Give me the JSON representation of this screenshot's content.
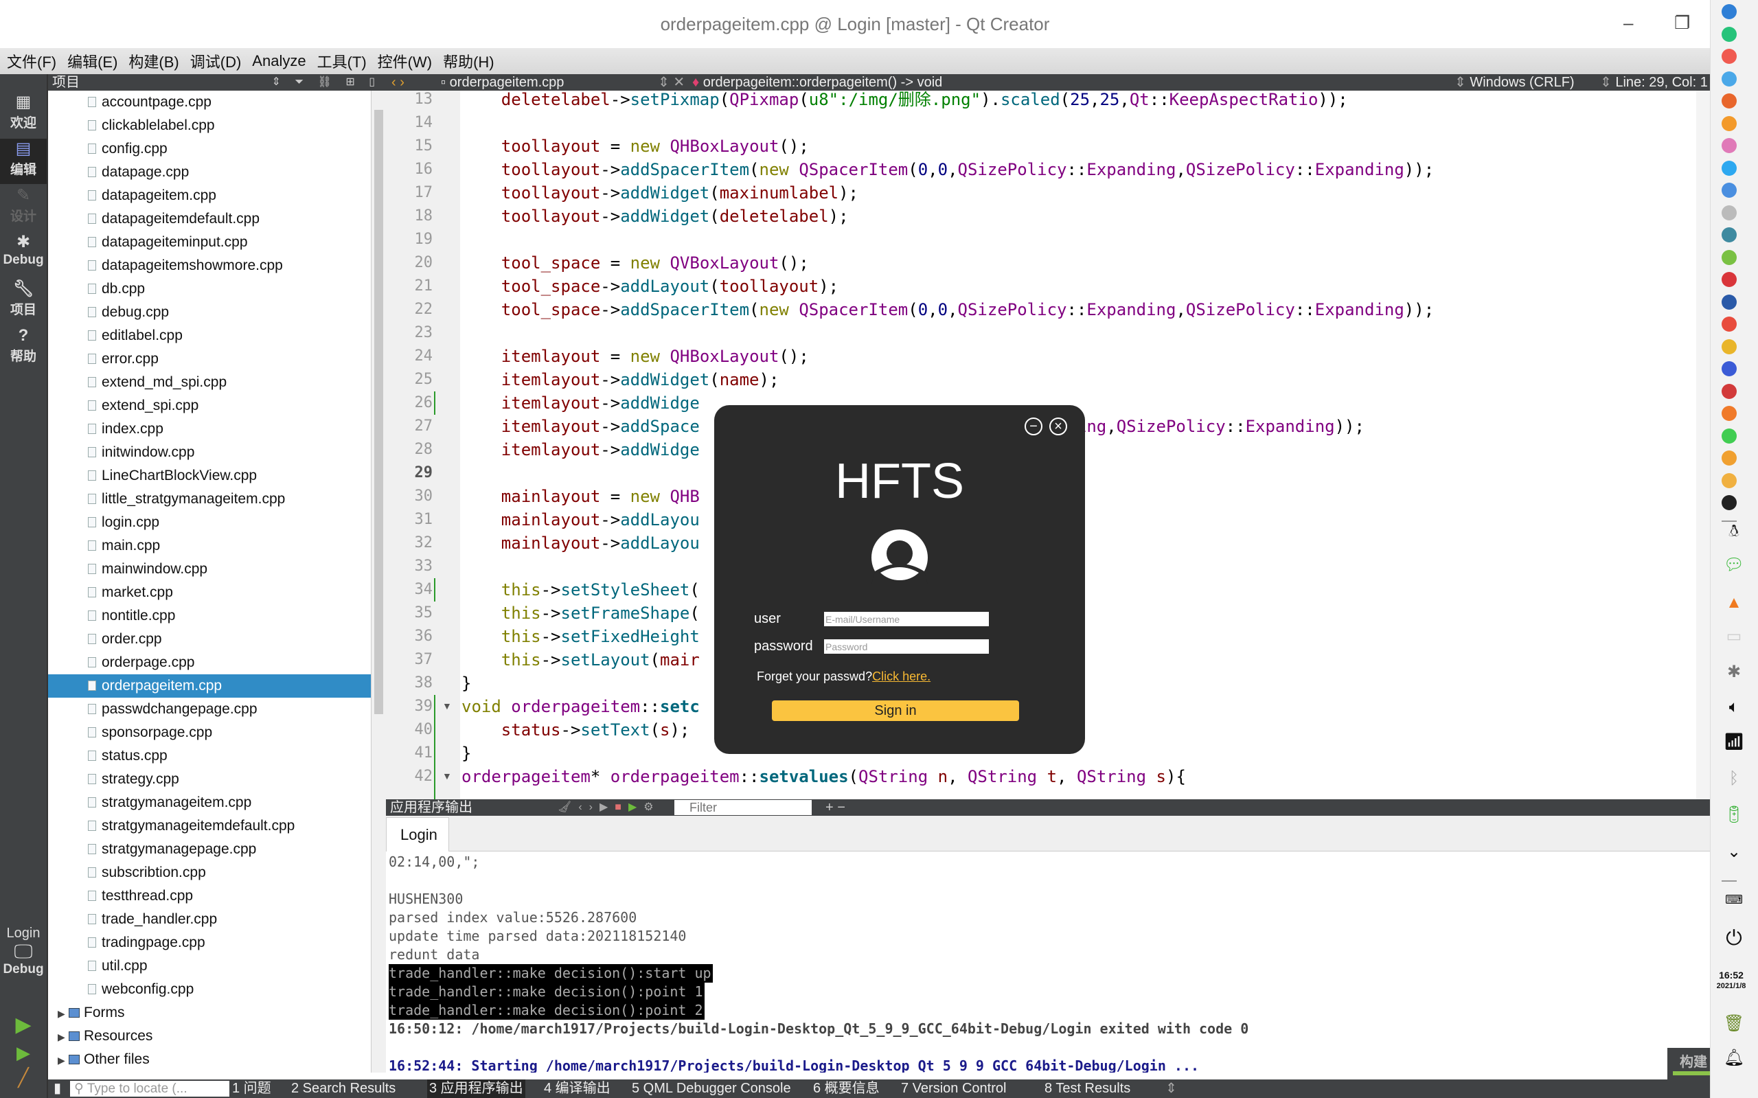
{
  "window": {
    "title": "orderpageitem.cpp @ Login [master] - Qt Creator",
    "minimize_glyph": "–",
    "restore_glyph": "❐"
  },
  "menubar": [
    "文件(F)",
    "编辑(E)",
    "构建(B)",
    "调试(D)",
    "Analyze",
    "工具(T)",
    "控件(W)",
    "帮助(H)"
  ],
  "modes": [
    {
      "label": "欢迎",
      "icon": "grid-icon"
    },
    {
      "label": "编辑",
      "icon": "edit-document-icon",
      "active": true
    },
    {
      "label": "设计",
      "icon": "pencil-icon",
      "disabled": true
    },
    {
      "label": "Debug",
      "icon": "bug-icon"
    },
    {
      "label": "项目",
      "icon": "wrench-icon"
    },
    {
      "label": "帮助",
      "icon": "help-icon"
    }
  ],
  "run_target": {
    "project": "Login",
    "config": "Debug"
  },
  "project_panel": {
    "title": "项目",
    "files": [
      "accountpage.cpp",
      "clickablelabel.cpp",
      "config.cpp",
      "datapage.cpp",
      "datapageitem.cpp",
      "datapageitemdefault.cpp",
      "datapageiteminput.cpp",
      "datapageitemshowmore.cpp",
      "db.cpp",
      "debug.cpp",
      "editlabel.cpp",
      "error.cpp",
      "extend_md_spi.cpp",
      "extend_spi.cpp",
      "index.cpp",
      "initwindow.cpp",
      "LineChartBlockView.cpp",
      "little_stratgymanageitem.cpp",
      "login.cpp",
      "main.cpp",
      "mainwindow.cpp",
      "market.cpp",
      "nontitle.cpp",
      "order.cpp",
      "orderpage.cpp",
      "orderpageitem.cpp",
      "passwdchangepage.cpp",
      "sponsorpage.cpp",
      "status.cpp",
      "strategy.cpp",
      "stratgymanageitem.cpp",
      "stratgymanageitemdefault.cpp",
      "stratgymanagepage.cpp",
      "subscribtion.cpp",
      "testthread.cpp",
      "trade_handler.cpp",
      "tradingpage.cpp",
      "util.cpp",
      "webconfig.cpp"
    ],
    "selected_file": "orderpageitem.cpp",
    "folders": [
      "Forms",
      "Resources",
      "Other files"
    ]
  },
  "editor_toolbar": {
    "file": "orderpageitem.cpp",
    "symbol": "orderpageitem::orderpageitem() -> void",
    "line_ending": "Windows (CRLF)",
    "position": "Line: 29, Col: 1"
  },
  "editor": {
    "current_line": 29,
    "lines": [
      {
        "n": 13,
        "html": "    <span class='v'>deletelabel</span>-><span class='f'>setPixmap</span>(<span class='t'>QPixmap</span>(<span class='s'>u8\":/img/删除.png\"</span>).<span class='f'>scaled</span>(<span class='n'>25</span>,<span class='n'>25</span>,<span class='t'>Qt</span>::<span class='t'>KeepAspectRatio</span>));"
      },
      {
        "n": 14,
        "html": ""
      },
      {
        "n": 15,
        "html": "    <span class='v'>toollayout</span> = <span class='k'>new</span> <span class='t'>QHBoxLayout</span>();"
      },
      {
        "n": 16,
        "html": "    <span class='v'>toollayout</span>-><span class='f'>addSpacerItem</span>(<span class='k'>new</span> <span class='t'>QSpacerItem</span>(<span class='n'>0</span>,<span class='n'>0</span>,<span class='t'>QSizePolicy</span>::<span class='t'>Expanding</span>,<span class='t'>QSizePolicy</span>::<span class='t'>Expanding</span>));"
      },
      {
        "n": 17,
        "html": "    <span class='v'>toollayout</span>-><span class='f'>addWidget</span>(<span class='v'>maxinumlabel</span>);"
      },
      {
        "n": 18,
        "html": "    <span class='v'>toollayout</span>-><span class='f'>addWidget</span>(<span class='v'>deletelabel</span>);"
      },
      {
        "n": 19,
        "html": ""
      },
      {
        "n": 20,
        "html": "    <span class='v'>tool_space</span> = <span class='k'>new</span> <span class='t'>QVBoxLayout</span>();"
      },
      {
        "n": 21,
        "html": "    <span class='v'>tool_space</span>-><span class='f'>addLayout</span>(<span class='v'>toollayout</span>);"
      },
      {
        "n": 22,
        "html": "    <span class='v'>tool_space</span>-><span class='f'>addSpacerItem</span>(<span class='k'>new</span> <span class='t'>QSpacerItem</span>(<span class='n'>0</span>,<span class='n'>0</span>,<span class='t'>QSizePolicy</span>::<span class='t'>Expanding</span>,<span class='t'>QSizePolicy</span>::<span class='t'>Expanding</span>));"
      },
      {
        "n": 23,
        "html": ""
      },
      {
        "n": 24,
        "html": "    <span class='v'>itemlayout</span> = <span class='k'>new</span> <span class='t'>QHBoxLayout</span>();"
      },
      {
        "n": 25,
        "html": "    <span class='v'>itemlayout</span>-><span class='f'>addWidget</span>(<span class='v'>name</span>);"
      },
      {
        "n": 26,
        "html": "    <span class='v'>itemlayout</span>-><span class='f'>addWidge</span>"
      },
      {
        "n": 27,
        "html": "    <span class='v'>itemlayout</span>-><span class='f'>addSpace</span>                           <span class='t'>icy</span>::<span class='t'>Expanding</span>,<span class='t'>QSizePolicy</span>::<span class='t'>Expanding</span>));"
      },
      {
        "n": 28,
        "html": "    <span class='v'>itemlayout</span>-><span class='f'>addWidge</span>"
      },
      {
        "n": 29,
        "html": ""
      },
      {
        "n": 30,
        "html": "    <span class='v'>mainlayout</span> = <span class='k'>new</span> <span class='t'>QHB</span>"
      },
      {
        "n": 31,
        "html": "    <span class='v'>mainlayout</span>-><span class='f'>addLayou</span>"
      },
      {
        "n": 32,
        "html": "    <span class='v'>mainlayout</span>-><span class='f'>addLayou</span>"
      },
      {
        "n": 33,
        "html": ""
      },
      {
        "n": 34,
        "html": "    <span class='k'>this</span>-><span class='f'>setStyleSheet</span>(                          <span class='s'>pt '黑体'\"</span>);"
      },
      {
        "n": 35,
        "html": "    <span class='k'>this</span>-><span class='f'>setFrameShape</span>("
      },
      {
        "n": 36,
        "html": "    <span class='k'>this</span>-><span class='f'>setFixedHeight</span>"
      },
      {
        "n": 37,
        "html": "    <span class='k'>this</span>-><span class='f'>setLayout</span>(<span class='v'>mair</span>"
      },
      {
        "n": 38,
        "html": "}"
      },
      {
        "n": 39,
        "html": "<span class='k'>void</span> <span class='t'>orderpageitem</span>::<span class='b'>setc</span>",
        "fold": true
      },
      {
        "n": 40,
        "html": "    <span class='v'>status</span>-><span class='f'>setText</span>(<span class='v'>s</span>);"
      },
      {
        "n": 41,
        "html": "}"
      },
      {
        "n": 42,
        "html": "<span class='t'>orderpageitem</span>* <span class='t'>orderpageitem</span>::<span class='b'>setvalues</span>(<span class='t'>QString</span> <span class='v'>n</span>, <span class='t'>QString</span> <span class='v'>t</span>, <span class='t'>QString</span> <span class='v'>s</span>){",
        "fold": true
      }
    ]
  },
  "output_pane": {
    "title": "应用程序输出",
    "filter_placeholder": "Filter",
    "tab": "Login",
    "lines": [
      {
        "text": "02:14,00,\";",
        "style": ""
      },
      {
        "text": "",
        "style": ""
      },
      {
        "text": "HUSHEN300",
        "style": ""
      },
      {
        "text": "parsed index value:5526.287600",
        "style": ""
      },
      {
        "text": "update time parsed data:202118152140",
        "style": ""
      },
      {
        "text": "redunt data",
        "style": ""
      },
      {
        "text": "trade_handler::make decision():start up",
        "style": "inv"
      },
      {
        "text": "trade_handler::make decision():point 1",
        "style": "inv"
      },
      {
        "text": "trade_handler::make decision():point 2",
        "style": "inv"
      },
      {
        "text": "16:50:12: /home/march1917/Projects/build-Login-Desktop_Qt_5_9_9_GCC_64bit-Debug/Login exited with code 0",
        "style": "bold"
      },
      {
        "text": "",
        "style": ""
      },
      {
        "text": "16:52:44: Starting /home/march1917/Projects/build-Login-Desktop_Qt_5_9_9_GCC_64bit-Debug/Login ...",
        "style": "blue"
      }
    ]
  },
  "statusbar": {
    "locate_placeholder": "Type to locate (...",
    "panes": [
      "1 问题",
      "2 Search Results",
      "3 应用程序输出",
      "4 编译输出",
      "5 QML Debugger Console",
      "6 概要信息",
      "7 Version Control",
      "8 Test Results"
    ],
    "active_pane": "3 应用程序输出",
    "build_label": "构建"
  },
  "login_dialog": {
    "brand": "HFTS",
    "user_label": "user",
    "user_placeholder": "E-mail/Username",
    "password_label": "password",
    "password_placeholder": "Password",
    "forget_text": "Forget your passwd?",
    "forget_link": "Click here.",
    "signin_label": "Sign in",
    "accent": "#fbc440",
    "link_color": "#f8b933"
  },
  "dock": {
    "time": "16:52",
    "date": "2021/1/8",
    "apps": [
      {
        "name": "deepin-launcher-icon",
        "color": "#2f7fd6"
      },
      {
        "name": "terminal-icon",
        "color": "#27c37a"
      },
      {
        "name": "screen-recorder-icon",
        "color": "#f05a50"
      },
      {
        "name": "file-manager-icon",
        "color": "#4ba8e8"
      },
      {
        "name": "firefox-icon",
        "color": "#e8662c"
      },
      {
        "name": "app-store-icon",
        "color": "#f39a2b"
      },
      {
        "name": "music-icon",
        "color": "#e07ab8"
      },
      {
        "name": "chat-icon",
        "color": "#2da8f0"
      },
      {
        "name": "network-icon",
        "color": "#4a8fe0"
      },
      {
        "name": "font-icon",
        "color": "#bbbbbb"
      },
      {
        "name": "atom-icon",
        "color": "#3e8aa0"
      },
      {
        "name": "wechat-icon",
        "color": "#7ac143"
      },
      {
        "name": "netease-music-icon",
        "color": "#d9353a"
      },
      {
        "name": "vscode-icon",
        "color": "#2a5aa8"
      },
      {
        "name": "pdf-icon",
        "color": "#e84c3d"
      },
      {
        "name": "chrome-icon",
        "color": "#e9b52a"
      },
      {
        "name": "wps-icon",
        "color": "#3b5bd6"
      },
      {
        "name": "xmind-icon",
        "color": "#d23a3a"
      },
      {
        "name": "image-viewer-icon",
        "color": "#f07a2a"
      },
      {
        "name": "qt-creator-icon",
        "color": "#41cd52"
      },
      {
        "name": "qq-icon",
        "color": "#f0a030"
      },
      {
        "name": "notes-icon",
        "color": "#f0b040"
      },
      {
        "name": "wallet-icon",
        "color": "#222222"
      }
    ],
    "tray": [
      "qq-tray-icon",
      "wechat-tray-icon",
      "vlc-icon",
      "keyboard-layout-icon",
      "input-method-icon",
      "volume-icon",
      "wifi-icon",
      "bluetooth-icon",
      "battery-icon",
      "chevron-down-icon",
      "onscreen-keyboard-icon",
      "power-icon"
    ]
  }
}
